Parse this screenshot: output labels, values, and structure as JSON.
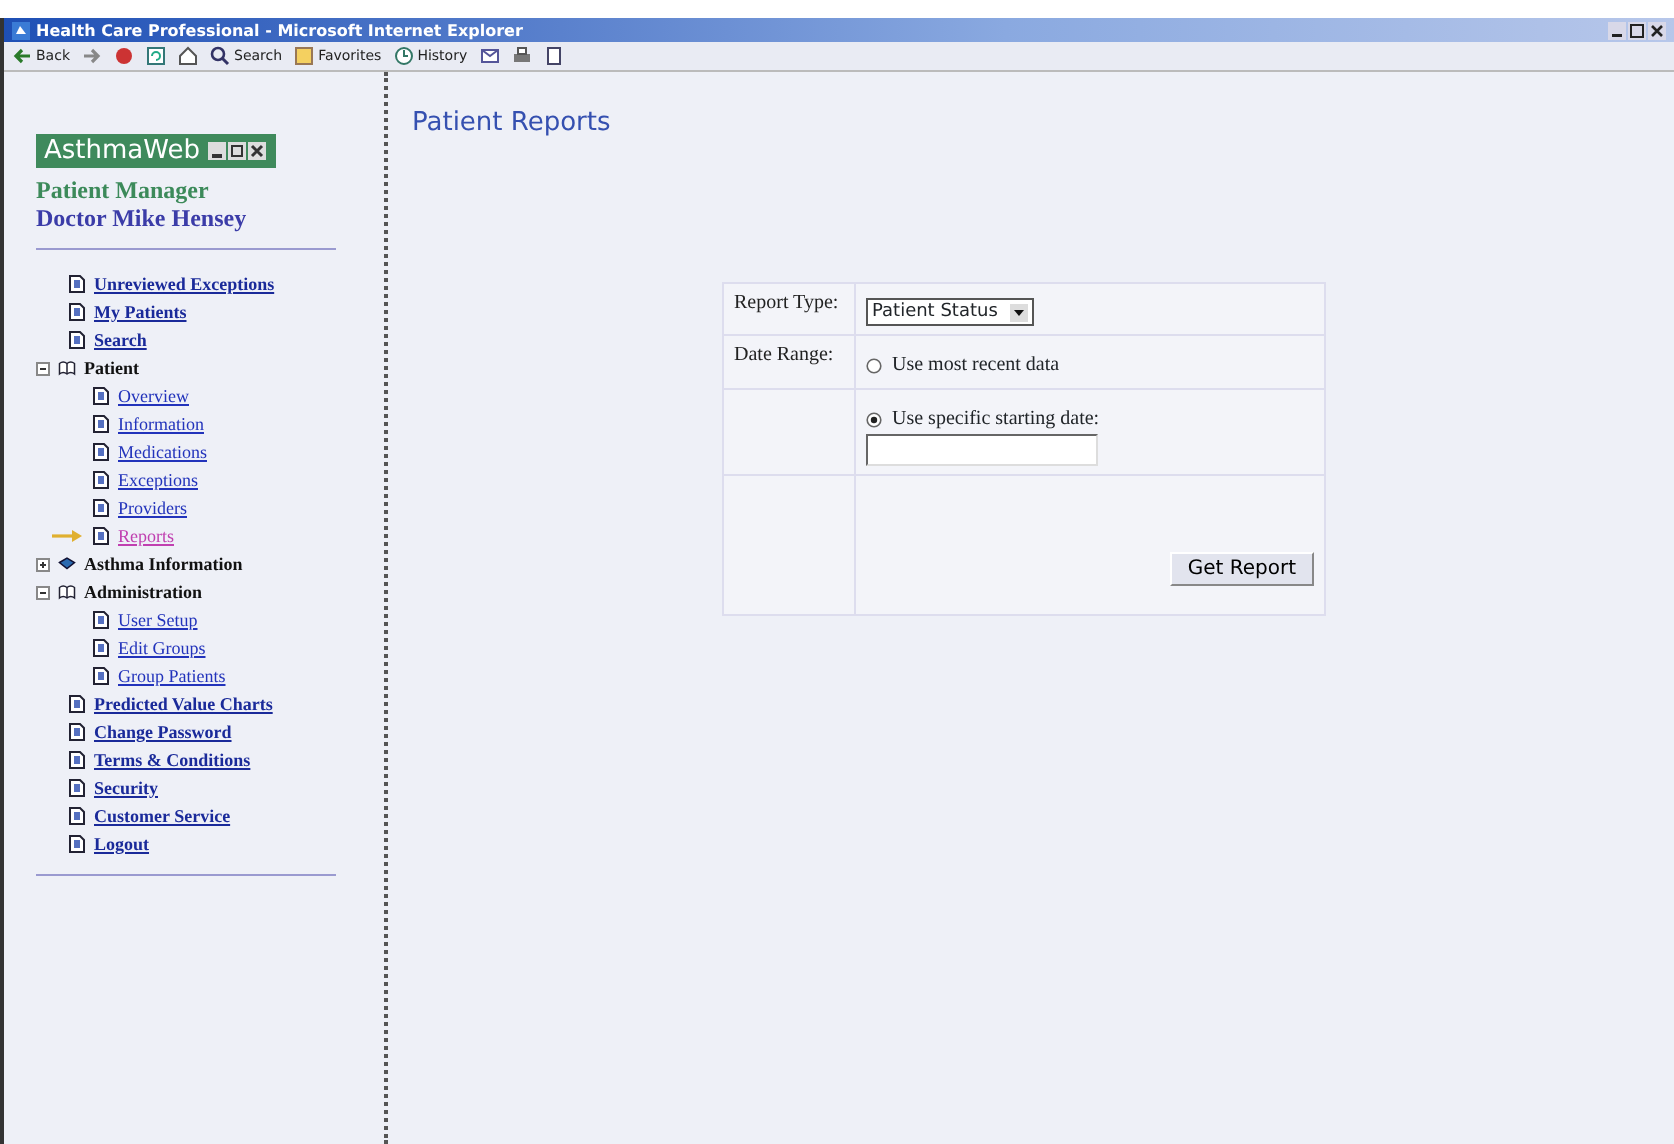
{
  "window": {
    "title": "Health Care Professional - Microsoft Internet Explorer"
  },
  "toolbar": [
    {
      "label": "Back",
      "kind": "back"
    },
    {
      "kind": "forward"
    },
    {
      "kind": "stop"
    },
    {
      "kind": "refresh"
    },
    {
      "kind": "home"
    },
    {
      "label": "Search",
      "kind": "search"
    },
    {
      "label": "Favorites",
      "kind": "favorites"
    },
    {
      "label": "History",
      "kind": "history"
    },
    {
      "kind": "mail"
    },
    {
      "kind": "print"
    },
    {
      "kind": "edit"
    }
  ],
  "sidebar": {
    "logo": "AsthmaWeb",
    "subtitle": "Patient Manager",
    "user": "Doctor Mike Hensey",
    "items": [
      {
        "label": "Unreviewed Exceptions",
        "kind": "link",
        "selected": false
      },
      {
        "label": "My Patients",
        "kind": "link",
        "selected": false
      },
      {
        "label": "Search",
        "kind": "link",
        "selected": false
      },
      {
        "label": "Patient",
        "kind": "group",
        "expanded": true,
        "children": [
          {
            "label": "Overview",
            "kind": "link",
            "selected": false
          },
          {
            "label": "Information",
            "kind": "link",
            "selected": false
          },
          {
            "label": "Medications",
            "kind": "link",
            "selected": false
          },
          {
            "label": "Exceptions",
            "kind": "link",
            "selected": false
          },
          {
            "label": "Providers",
            "kind": "link",
            "selected": false
          },
          {
            "label": "Reports",
            "kind": "link",
            "selected": true
          }
        ]
      },
      {
        "label": "Asthma Information",
        "kind": "group",
        "expanded": false
      },
      {
        "label": "Administration",
        "kind": "group",
        "expanded": true,
        "children": [
          {
            "label": "User Setup",
            "kind": "link",
            "selected": false
          },
          {
            "label": "Edit Groups",
            "kind": "link",
            "selected": false
          },
          {
            "label": "Group Patients",
            "kind": "link",
            "selected": false
          }
        ]
      },
      {
        "label": "Predicted Value Charts",
        "kind": "link",
        "selected": false
      },
      {
        "label": "Change Password",
        "kind": "link",
        "selected": false
      },
      {
        "label": "Terms & Conditions",
        "kind": "link",
        "selected": false
      },
      {
        "label": "Security",
        "kind": "link",
        "selected": false
      },
      {
        "label": "Customer Service",
        "kind": "link",
        "selected": false
      },
      {
        "label": "Logout",
        "kind": "link",
        "selected": false
      }
    ]
  },
  "main": {
    "heading": "Patient Reports",
    "form": {
      "report_type_label": "Report Type:",
      "report_type": "Patient Status",
      "date_range_label": "Date Range:",
      "options": [
        {
          "label": "Use most recent data",
          "selected": false
        },
        {
          "label": "Use specific starting date:",
          "selected": true
        }
      ],
      "button": "Get Report"
    }
  }
}
